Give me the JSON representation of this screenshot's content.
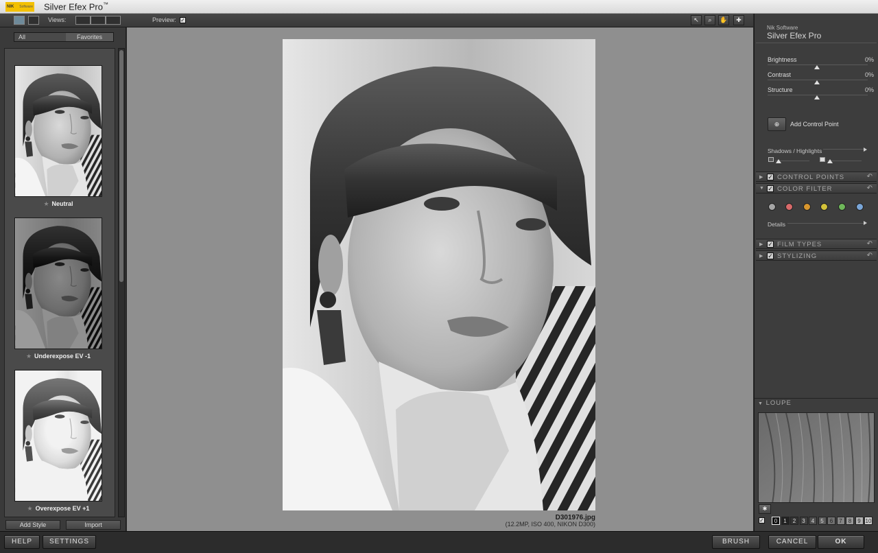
{
  "window": {
    "title": "Silver Efex Pro",
    "trademark": "™",
    "logo_text": "NIK",
    "logo_sub": "Software"
  },
  "toolbar": {
    "views_label": "Views:",
    "preview_label": "Preview:",
    "preview_checked": true,
    "tools": [
      "pointer-icon",
      "zoom-icon",
      "hand-icon",
      "control-point-tool-icon"
    ]
  },
  "left": {
    "tabs": [
      "All",
      "Favorites"
    ],
    "presets": [
      {
        "label": "Neutral",
        "tone": "normal"
      },
      {
        "label": "Underexpose EV -1",
        "tone": "dark"
      },
      {
        "label": "Overexpose EV +1",
        "tone": "bright"
      }
    ],
    "add_style": "Add Style",
    "import": "Import"
  },
  "canvas": {
    "file_name": "D301976.jpg",
    "file_info": "(12.2MP, ISO 400, NIKON D300)"
  },
  "right": {
    "brand_small": "Nik Software",
    "brand_big": "Silver Efex Pro",
    "sliders": [
      {
        "label": "Brightness",
        "value": "0%"
      },
      {
        "label": "Contrast",
        "value": "0%"
      },
      {
        "label": "Structure",
        "value": "0%"
      }
    ],
    "add_control_point": "Add Control Point",
    "shadows_highlights": "Shadows / Highlights",
    "sections": [
      {
        "name": "CONTROL POINTS",
        "expanded": false
      },
      {
        "name": "COLOR FILTER",
        "expanded": true
      },
      {
        "name": "FILM TYPES",
        "expanded": false
      },
      {
        "name": "STYLIZING",
        "expanded": false
      }
    ],
    "color_filters": [
      "#a6a6a6",
      "#d86a6a",
      "#d8962e",
      "#d4c23a",
      "#6fb85a",
      "#7aa6d8"
    ],
    "details_label": "Details",
    "loupe_label": "LOUPE",
    "zoom_levels": [
      "0",
      "1",
      "2",
      "3",
      "4",
      "5",
      "6",
      "7",
      "8",
      "9",
      "10"
    ]
  },
  "bottom": {
    "help": "HELP",
    "settings": "SETTINGS",
    "brush": "BRUSH",
    "cancel": "CANCEL",
    "ok": "OK"
  }
}
